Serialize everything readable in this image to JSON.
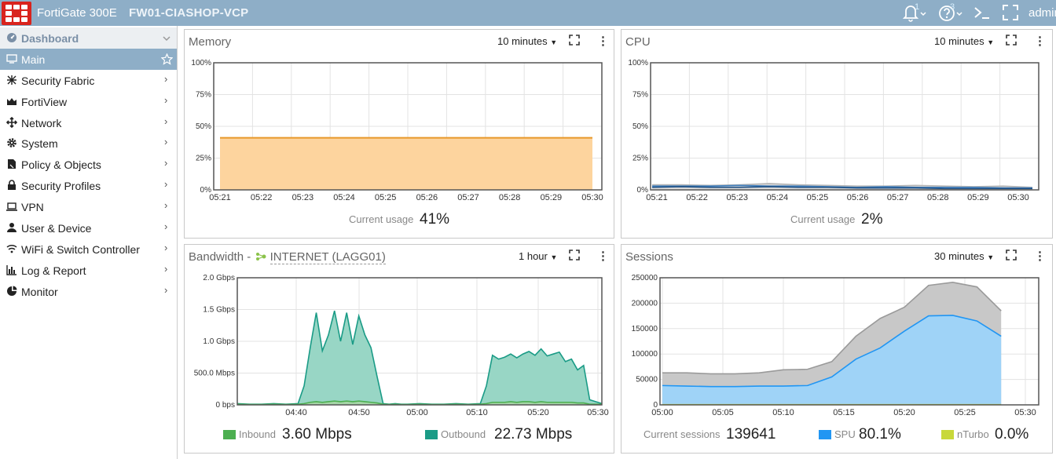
{
  "header": {
    "model": "FortiGate 300E",
    "hostname": "FW01-CIASHOP-VCP",
    "notifications_count": "1",
    "help_count": "3",
    "user": "admin"
  },
  "sidebar": {
    "items": [
      {
        "label": "Dashboard",
        "icon": "dashboard-icon"
      },
      {
        "label": "Main",
        "icon": "monitor-icon"
      },
      {
        "label": "Security Fabric",
        "icon": "fabric-icon"
      },
      {
        "label": "FortiView",
        "icon": "chart-icon"
      },
      {
        "label": "Network",
        "icon": "network-arrows-icon"
      },
      {
        "label": "System",
        "icon": "gear-icon"
      },
      {
        "label": "Policy & Objects",
        "icon": "policy-icon"
      },
      {
        "label": "Security Profiles",
        "icon": "lock-icon"
      },
      {
        "label": "VPN",
        "icon": "laptop-icon"
      },
      {
        "label": "User & Device",
        "icon": "user-icon"
      },
      {
        "label": "WiFi & Switch Controller",
        "icon": "wifi-icon"
      },
      {
        "label": "Log & Report",
        "icon": "bar-chart-icon"
      },
      {
        "label": "Monitor",
        "icon": "pie-icon"
      }
    ]
  },
  "panels": {
    "memory": {
      "title": "Memory",
      "range": "10 minutes",
      "usage_label": "Current usage",
      "usage_value": "41%"
    },
    "cpu": {
      "title": "CPU",
      "range": "10 minutes",
      "usage_label": "Current usage",
      "usage_value": "2%"
    },
    "bandwidth": {
      "title_prefix": "Bandwidth -",
      "interface": "INTERNET (LAGG01)",
      "range": "1 hour",
      "inbound_label": "Inbound",
      "inbound_value": "3.60 Mbps",
      "outbound_label": "Outbound",
      "outbound_value": "22.73 Mbps"
    },
    "sessions": {
      "title": "Sessions",
      "range": "30 minutes",
      "current_label": "Current sessions",
      "current_value": "139641",
      "spu_label": "SPU",
      "spu_value": "80.1%",
      "nturbo_label": "nTurbo",
      "nturbo_value": "0.0%"
    }
  },
  "colors": {
    "memory_fill": "#fdd49e",
    "memory_line": "#e8982a",
    "cpu_line": "#3f7fbf",
    "cpu_gray": "#b4b4b4",
    "inbound": "#4caf50",
    "outbound": "#1a9b86",
    "outbound_fill": "#98d6c5",
    "sessions_gray": "#c8c8c8",
    "spu": "#2196f3",
    "spu_fill": "#9fd3f7",
    "nturbo": "#c8d83a",
    "accent": "#8eaec7"
  },
  "chart_data": [
    {
      "type": "area",
      "title": "Memory",
      "x": [
        "05:21",
        "05:22",
        "05:23",
        "05:24",
        "05:25",
        "05:26",
        "05:27",
        "05:28",
        "05:29",
        "05:30"
      ],
      "xticks": [
        "05:21",
        "05:22",
        "05:23",
        "05:24",
        "05:25",
        "05:26",
        "05:27",
        "05:28",
        "05:29",
        "05:30"
      ],
      "yticks": [
        "0%",
        "25%",
        "50%",
        "75%",
        "100%"
      ],
      "ylim": [
        0,
        100
      ],
      "series": [
        {
          "values": [
            41,
            41,
            41,
            41,
            41,
            41,
            41,
            41,
            41,
            41
          ]
        }
      ],
      "grid": true
    },
    {
      "type": "area",
      "title": "CPU",
      "x": [
        "05:21",
        "05:22",
        "05:23",
        "05:24",
        "05:25",
        "05:26",
        "05:27",
        "05:28",
        "05:29",
        "05:30"
      ],
      "xticks": [
        "05:21",
        "05:22",
        "05:23",
        "05:24",
        "05:25",
        "05:26",
        "05:27",
        "05:28",
        "05:29",
        "05:30"
      ],
      "yticks": [
        "0%",
        "25%",
        "50%",
        "75%",
        "100%"
      ],
      "ylim": [
        0,
        100
      ],
      "series": [
        {
          "values": [
            4,
            4,
            3.5,
            4,
            5,
            4,
            3.5,
            3,
            3,
            3.5,
            3,
            2.5,
            3,
            2
          ]
        },
        {
          "values": [
            3,
            3,
            3,
            3.5,
            3,
            3,
            2.5,
            2,
            2.5,
            2,
            2,
            2,
            1.5,
            1.5
          ]
        },
        {
          "values": [
            2,
            2.5,
            2,
            2,
            2.5,
            2,
            2,
            1.5,
            1.5,
            1.5,
            1,
            1,
            1,
            1
          ]
        }
      ],
      "grid": true
    },
    {
      "type": "area",
      "title": "Bandwidth - INTERNET (LAGG01)",
      "x_minutes": [
        0,
        2,
        4,
        6,
        8,
        10,
        11,
        12,
        13,
        14,
        15,
        16,
        17,
        18,
        19,
        20,
        21,
        22,
        23,
        24,
        25,
        26,
        27,
        28,
        30,
        32,
        34,
        36,
        38,
        40,
        41,
        42,
        43,
        44,
        45,
        46,
        47,
        48,
        49,
        50,
        51,
        52,
        53,
        54,
        55,
        56,
        57,
        58,
        60
      ],
      "xticks": [
        "04:40",
        "04:50",
        "05:00",
        "05:10",
        "05:20",
        "05:30"
      ],
      "yticks": [
        "0 bps",
        "500.0 Mbps",
        "1.0 Gbps",
        "1.5 Gbps",
        "2.0 Gbps"
      ],
      "ylim_gbps": [
        0,
        2.0
      ],
      "series": [
        {
          "values_gbps": [
            0.02,
            0.01,
            0.01,
            0.02,
            0.01,
            0.02,
            0.3,
            0.9,
            1.45,
            0.85,
            1.1,
            1.48,
            1.0,
            1.45,
            0.95,
            1.4,
            1.1,
            0.9,
            0.45,
            0.02,
            0.01,
            0.02,
            0.01,
            0.01,
            0.02,
            0.01,
            0.01,
            0.02,
            0.01,
            0.02,
            0.3,
            0.78,
            0.72,
            0.75,
            0.8,
            0.74,
            0.8,
            0.84,
            0.78,
            0.88,
            0.77,
            0.8,
            0.83,
            0.68,
            0.72,
            0.55,
            0.62,
            0.08,
            0.02
          ]
        },
        {
          "values_gbps": [
            0.01,
            0.005,
            0.005,
            0.01,
            0.005,
            0.01,
            0.02,
            0.04,
            0.05,
            0.04,
            0.05,
            0.06,
            0.05,
            0.06,
            0.05,
            0.06,
            0.05,
            0.04,
            0.03,
            0.01,
            0.005,
            0.01,
            0.005,
            0.005,
            0.01,
            0.005,
            0.005,
            0.01,
            0.005,
            0.01,
            0.02,
            0.04,
            0.04,
            0.04,
            0.05,
            0.04,
            0.05,
            0.05,
            0.04,
            0.05,
            0.04,
            0.04,
            0.04,
            0.04,
            0.04,
            0.03,
            0.03,
            0.01,
            0.01
          ]
        }
      ],
      "grid": true
    },
    {
      "type": "area",
      "title": "Sessions",
      "x_minutes": [
        0,
        2,
        4,
        6,
        8,
        10,
        12,
        14,
        16,
        18,
        20,
        22,
        24,
        26,
        28
      ],
      "xticks": [
        "05:00",
        "05:05",
        "05:10",
        "05:15",
        "05:20",
        "05:25",
        "05:30"
      ],
      "yticks": [
        "0",
        "50000",
        "100000",
        "150000",
        "200000",
        "250000"
      ],
      "ylim": [
        0,
        250000
      ],
      "series": [
        {
          "values": [
            63000,
            63000,
            61000,
            61000,
            63000,
            69000,
            70000,
            85000,
            135000,
            170000,
            192000,
            235000,
            241000,
            232000,
            185000
          ]
        },
        {
          "values": [
            38000,
            37000,
            36000,
            36000,
            37000,
            37000,
            38000,
            55000,
            90000,
            112000,
            145000,
            175000,
            176000,
            165000,
            135000
          ]
        },
        {
          "values": [
            500,
            500,
            500,
            500,
            500,
            500,
            500,
            500,
            500,
            500,
            500,
            500,
            500,
            500,
            500
          ]
        }
      ],
      "grid": true
    }
  ]
}
